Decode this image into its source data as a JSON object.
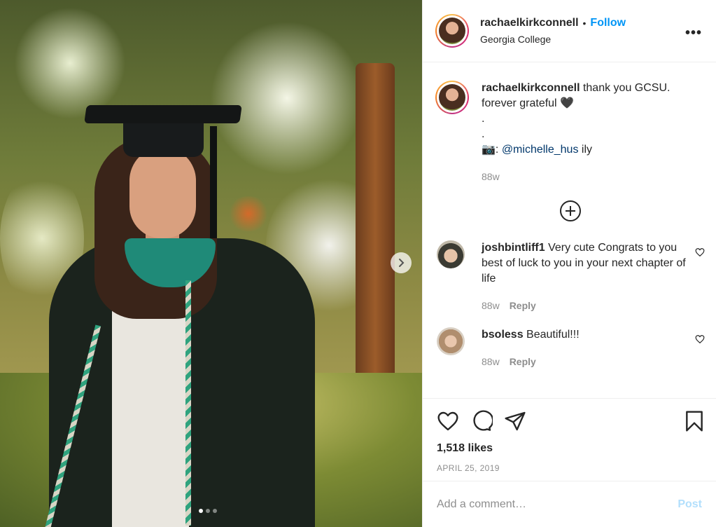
{
  "header": {
    "username": "rachaelkirkconnell",
    "separator": "•",
    "follow_label": "Follow",
    "location": "Georgia College",
    "more_label": "•••"
  },
  "caption": {
    "username": "rachaelkirkconnell",
    "text_line1": " thank you GCSU.",
    "text_line2": "forever grateful 🖤",
    "text_line3": ".",
    "text_line4": ".",
    "camera": "📷: ",
    "mention": "@michelle_hus",
    "suffix": " ily",
    "time": "88w"
  },
  "comments": [
    {
      "username": "joshbintliff1",
      "text": " Very cute Congrats to you best of luck to you in your next chapter of life",
      "time": "88w",
      "reply_label": "Reply"
    },
    {
      "username": "bsoless",
      "text": " Beautiful!!!",
      "time": "88w",
      "reply_label": "Reply"
    }
  ],
  "actions": {
    "likes": "1,518 likes",
    "date": "APRIL 25, 2019"
  },
  "add_comment": {
    "placeholder": "Add a comment…",
    "post_label": "Post"
  },
  "carousel": {
    "current": 1,
    "total": 3
  },
  "colors": {
    "link_blue": "#0095f6",
    "mention": "#00376b",
    "muted": "#8e8e8e"
  }
}
